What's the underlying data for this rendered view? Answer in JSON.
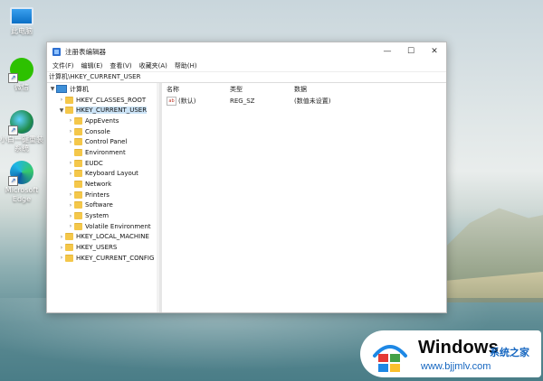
{
  "desktop": {
    "icons": [
      {
        "label": "此电脑",
        "icon": "computer-icon"
      },
      {
        "label": "微信",
        "icon": "wechat-icon"
      },
      {
        "label": "小白一键重装系统",
        "icon": "reinstall-helper-icon"
      },
      {
        "label": "Microsoft Edge",
        "icon": "edge-icon"
      }
    ]
  },
  "window": {
    "title": "注册表编辑器",
    "controls": {
      "minimize": "—",
      "maximize": "☐",
      "close": "✕"
    },
    "menu": [
      "文件(F)",
      "编辑(E)",
      "查看(V)",
      "收藏夹(A)",
      "帮助(H)"
    ],
    "address": "计算机\\HKEY_CURRENT_USER",
    "tree": {
      "root": "计算机",
      "items": [
        {
          "label": "HKEY_CLASSES_ROOT"
        },
        {
          "label": "HKEY_CURRENT_USER"
        },
        {
          "label": "AppEvents"
        },
        {
          "label": "Console"
        },
        {
          "label": "Control Panel"
        },
        {
          "label": "Environment"
        },
        {
          "label": "EUDC"
        },
        {
          "label": "Keyboard Layout"
        },
        {
          "label": "Network"
        },
        {
          "label": "Printers"
        },
        {
          "label": "Software"
        },
        {
          "label": "System"
        },
        {
          "label": "Volatile Environment"
        },
        {
          "label": "HKEY_LOCAL_MACHINE"
        },
        {
          "label": "HKEY_USERS"
        },
        {
          "label": "HKEY_CURRENT_CONFIG"
        }
      ]
    },
    "list": {
      "headers": {
        "name": "名称",
        "type": "类型",
        "data": "数据"
      },
      "rows": [
        {
          "icon_text": "ab",
          "name": "(默认)",
          "type": "REG_SZ",
          "data": "(数值未设置)"
        }
      ]
    }
  },
  "watermark": {
    "title": "Windows",
    "subtitle": "系统之家",
    "url": "www.bjjmlv.com",
    "colors": {
      "red": "#e53935",
      "green": "#43a047",
      "blue": "#1e88e5",
      "yellow": "#fbc02d"
    }
  }
}
